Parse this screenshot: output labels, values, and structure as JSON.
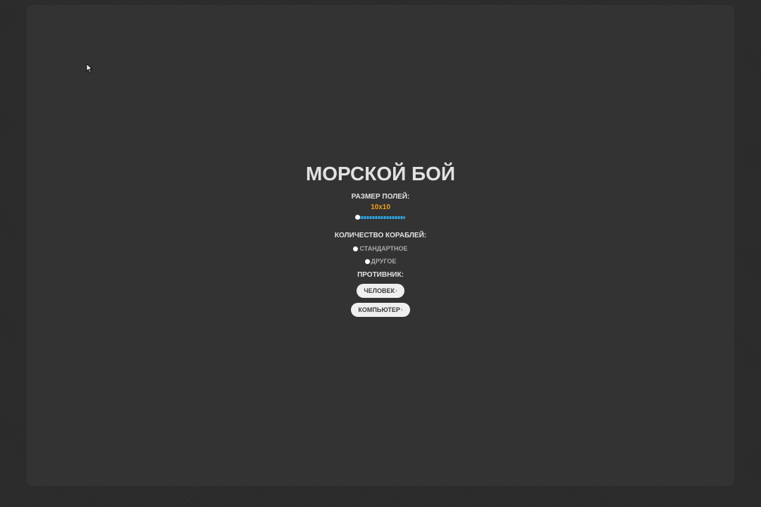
{
  "game": {
    "title": "МОРСКОЙ БОЙ"
  },
  "field_size": {
    "label": "РАЗМЕР ПОЛЕЙ:",
    "value": "10x10",
    "slider_level": 0.0
  },
  "ships": {
    "label": "КОЛИЧЕСТВО КОРАБЛЕЙ:",
    "options": [
      {
        "label": "СТАНДАРТНОЕ"
      },
      {
        "label": "ДРУГОЕ"
      }
    ]
  },
  "opponent": {
    "label": "ПРОТИВНИК:",
    "buttons": [
      {
        "label": "ЧЕЛОВЕК",
        "arrow": "›"
      },
      {
        "label": "КОМПЬЮТЕР",
        "arrow": "›"
      }
    ]
  },
  "colors": {
    "background": "#333333",
    "text": "#e2e2e2",
    "accent": "#f0a020",
    "slider": "#3aa6d8",
    "button": "#efefef"
  },
  "icons": {
    "cursor": "mouse-pointer-icon",
    "button_arrow": "chevron-right-icon"
  }
}
